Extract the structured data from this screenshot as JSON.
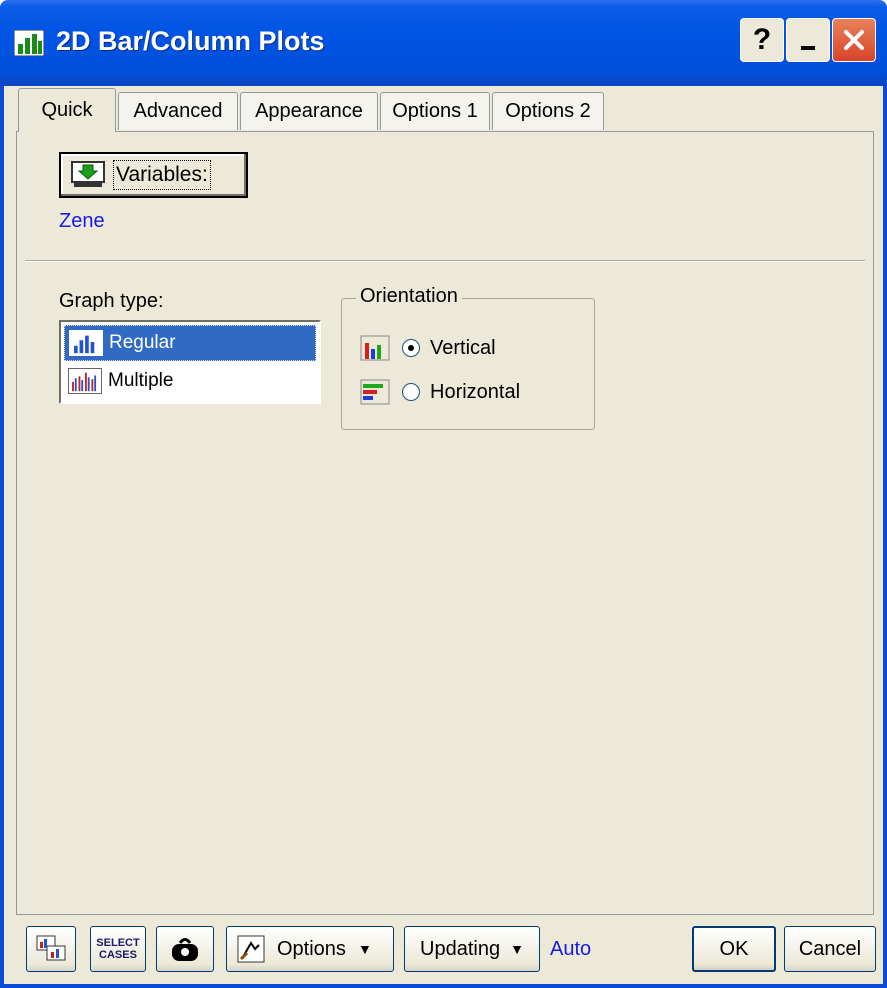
{
  "window": {
    "title": "2D Bar/Column Plots",
    "controls": {
      "help": "?",
      "minimize": "_",
      "close": "X"
    }
  },
  "tabs": [
    "Quick",
    "Advanced",
    "Appearance",
    "Options 1",
    "Options 2"
  ],
  "active_tab": "Quick",
  "quick": {
    "variables_button": "Variables:",
    "variables_value": "Zene",
    "graph_type_label": "Graph type:",
    "graph_types": [
      "Regular",
      "Multiple"
    ],
    "graph_type_selected": "Regular",
    "orientation_label": "Orientation",
    "orientation_options": [
      "Vertical",
      "Horizontal"
    ],
    "orientation_selected": "Vertical"
  },
  "footer": {
    "icon_buttons": [
      "summary-graph-icon",
      "select-cases-icon",
      "weight-icon"
    ],
    "select_cases_text_1": "SELECT",
    "select_cases_text_2": "CASES",
    "options_label": "Options",
    "updating_label": "Updating",
    "updating_value": "Auto",
    "ok_label": "OK",
    "cancel_label": "Cancel"
  },
  "colors": {
    "titlebar": "#0054e3",
    "link_blue": "#1a1adc",
    "dialog_bg": "#ece9d8",
    "selection": "#316ac5",
    "close": "#d8442a"
  }
}
